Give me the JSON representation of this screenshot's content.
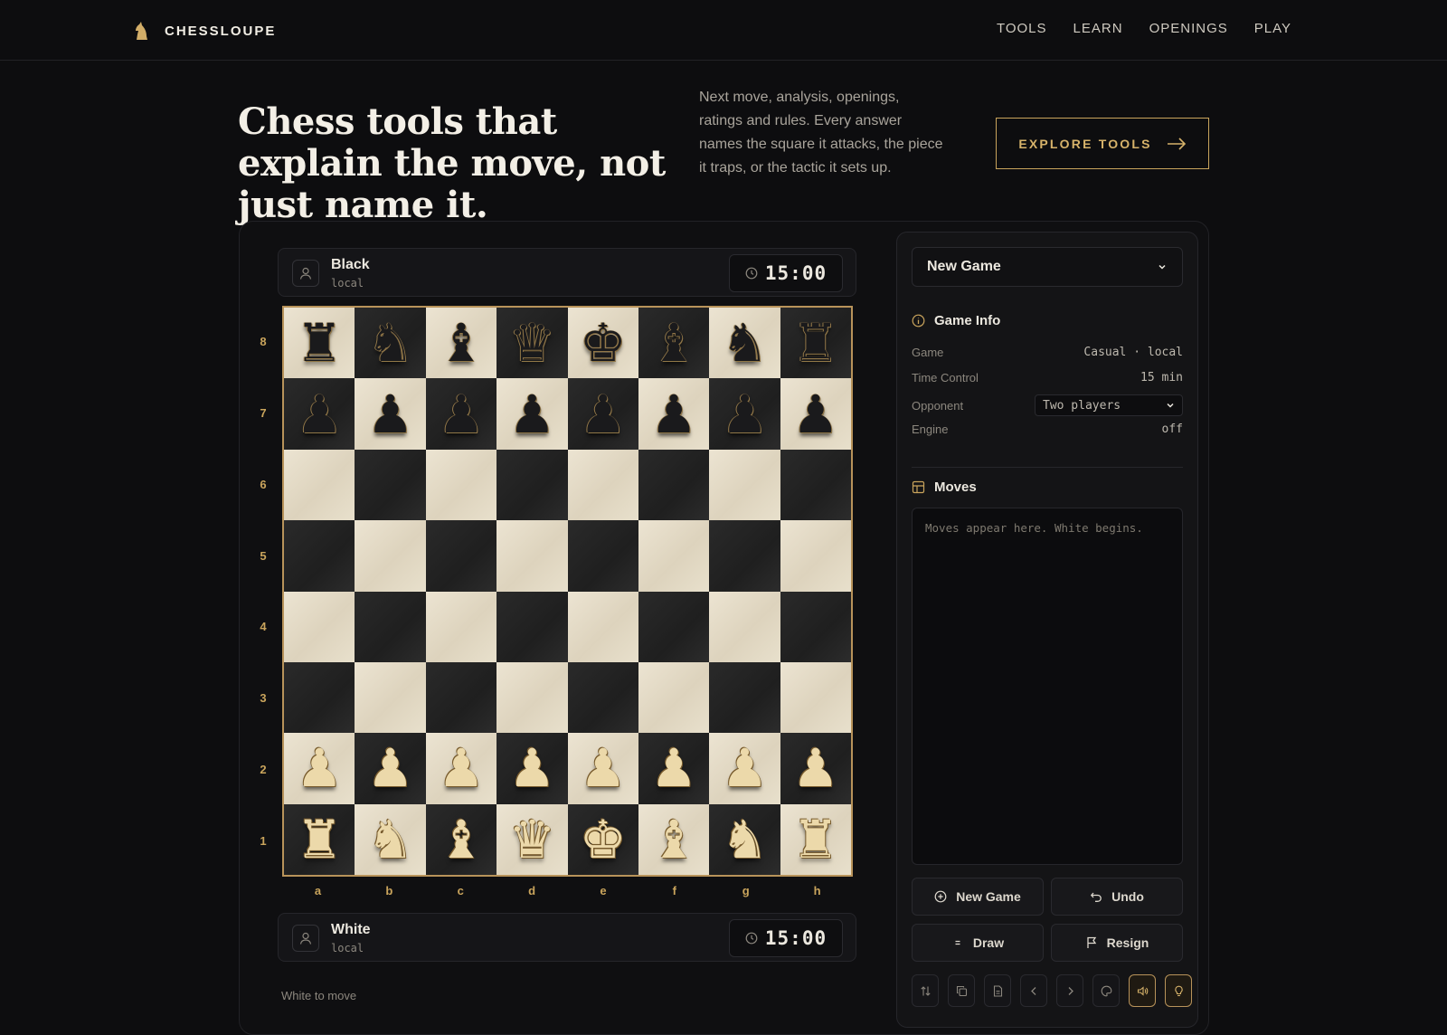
{
  "brand": {
    "name": "CHESSLOUPE"
  },
  "nav": [
    {
      "label": "TOOLS"
    },
    {
      "label": "LEARN"
    },
    {
      "label": "OPENINGS"
    },
    {
      "label": "PLAY"
    }
  ],
  "hero": {
    "title": "Chess tools that explain the move, not just name it.",
    "description": "Next move, analysis, openings, ratings and rules. Every answer names the square it attacks, the piece it traps, or the tactic it sets up.",
    "cta_label": "EXPLORE TOOLS"
  },
  "players": {
    "top": {
      "name": "Black",
      "sub": "local",
      "clock": "15:00"
    },
    "bottom": {
      "name": "White",
      "sub": "local",
      "clock": "15:00"
    }
  },
  "board": {
    "ranks": [
      "8",
      "7",
      "6",
      "5",
      "4",
      "3",
      "2",
      "1"
    ],
    "files": [
      "a",
      "b",
      "c",
      "d",
      "e",
      "f",
      "g",
      "h"
    ],
    "position": [
      [
        "bR",
        "bN",
        "bB",
        "bQ",
        "bK",
        "bB",
        "bN",
        "bR"
      ],
      [
        "bP",
        "bP",
        "bP",
        "bP",
        "bP",
        "bP",
        "bP",
        "bP"
      ],
      [
        "",
        "",
        "",
        "",
        "",
        "",
        "",
        ""
      ],
      [
        "",
        "",
        "",
        "",
        "",
        "",
        "",
        ""
      ],
      [
        "",
        "",
        "",
        "",
        "",
        "",
        "",
        ""
      ],
      [
        "",
        "",
        "",
        "",
        "",
        "",
        "",
        ""
      ],
      [
        "wP",
        "wP",
        "wP",
        "wP",
        "wP",
        "wP",
        "wP",
        "wP"
      ],
      [
        "wR",
        "wN",
        "wB",
        "wQ",
        "wK",
        "wB",
        "wN",
        "wR"
      ]
    ],
    "status": "White to move"
  },
  "side": {
    "game_select": "New Game",
    "info_title": "Game Info",
    "info": {
      "game_label": "Game",
      "game_value": "Casual · local",
      "time_label": "Time Control",
      "time_value": "15 min",
      "opponent_label": "Opponent",
      "opponent_value": "Two players",
      "engine_label": "Engine",
      "engine_value": "off"
    },
    "moves_title": "Moves",
    "moves_placeholder": "Moves appear here. White begins.",
    "buttons": {
      "new_game": "New Game",
      "undo": "Undo",
      "draw": "Draw",
      "resign": "Resign"
    },
    "tools": [
      "flip-board-icon",
      "copy-icon",
      "pgn-document-icon",
      "previous-move-icon",
      "next-move-icon",
      "theme-palette-icon",
      "sound-icon",
      "hint-bulb-icon"
    ]
  },
  "colors": {
    "accent": "#c9a45c",
    "background": "#0d0d0f"
  }
}
